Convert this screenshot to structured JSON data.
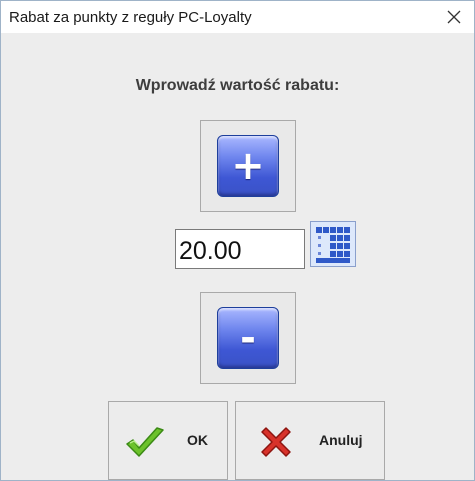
{
  "window": {
    "title": "Rabat za punkty z reguły PC-Loyalty",
    "close_icon": "close-icon"
  },
  "prompt": "Wprowadź wartość rabatu:",
  "increment": {
    "label": "+",
    "icon": "plus"
  },
  "value": "20.00",
  "decrement": {
    "label": "-",
    "icon": "minus"
  },
  "keypad_icon": "keypad-icon",
  "actions": {
    "ok_label": "OK",
    "cancel_label": "Anuluj"
  },
  "colors": {
    "button_blue": "#3e57d4",
    "ok_green": "#6cc22b",
    "cancel_red": "#d8322a"
  }
}
